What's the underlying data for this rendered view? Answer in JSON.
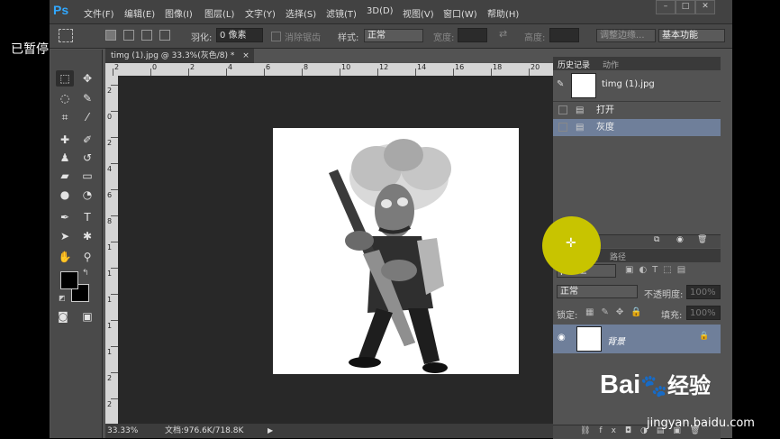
{
  "overlay": {
    "paused_label": "已暂停"
  },
  "app": {
    "logo": "Ps"
  },
  "menu": [
    "文件(F)",
    "编辑(E)",
    "图像(I)",
    "图层(L)",
    "文字(Y)",
    "选择(S)",
    "滤镜(T)",
    "3D(D)",
    "视图(V)",
    "窗口(W)",
    "帮助(H)"
  ],
  "window_controls": {
    "minimize": "–",
    "maximize": "□",
    "close": "✕"
  },
  "options": {
    "feather_label": "羽化:",
    "feather_value": "0 像素",
    "antialias_label": "消除锯齿",
    "style_label": "样式:",
    "style_value": "正常",
    "width_label": "宽度:",
    "height_label": "高度:",
    "refine_edge": "调整边缘...",
    "workspace": "基本功能"
  },
  "document": {
    "tab_title": "timg (1).jpg @ 33.3%(灰色/8) *",
    "close_glyph": "×",
    "zoom": "33.33%",
    "doc_info": "文档:976.6K/718.8K"
  },
  "ruler_top_labels": [
    "2",
    "0",
    "2",
    "4",
    "6",
    "8",
    "10",
    "12",
    "14",
    "16",
    "18",
    "20",
    "22"
  ],
  "ruler_left_labels": [
    "2",
    "0",
    "2",
    "4",
    "6",
    "8",
    "1",
    "1",
    "1",
    "1",
    "1",
    "2",
    "2"
  ],
  "history_panel": {
    "tabs": [
      "历史记录",
      "动作"
    ],
    "snapshot": "timg (1).jpg",
    "steps": [
      "打开",
      "灰度"
    ]
  },
  "layers_panel": {
    "tabs": [
      "图层",
      "通道",
      "路径"
    ],
    "filter_label": "ρ 类型",
    "blend_mode": "正常",
    "opacity_label": "不透明度:",
    "opacity_value": "100%",
    "lock_label": "锁定:",
    "fill_label": "填充:",
    "fill_value": "100%",
    "layer_name": "背景"
  },
  "watermark": {
    "brand": "Bai",
    "brand_suffix": "经验",
    "url": "jingyan.baidu.com"
  },
  "colors": {
    "accent": "#31a8ff",
    "selected_row": "#6f7f9a",
    "cursor_highlight": "#c8c400"
  }
}
